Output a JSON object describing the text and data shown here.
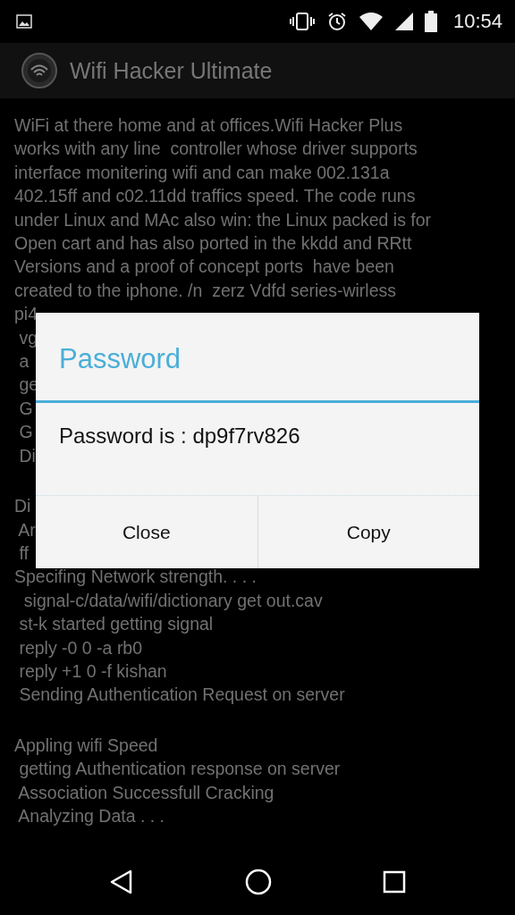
{
  "status_bar": {
    "time": "10:54"
  },
  "app_bar": {
    "title": "Wifi Hacker Ultimate"
  },
  "log_paragraphs": [
    [
      "WiFi at there home and at offices.Wifi Hacker Plus",
      "works with any line  controller whose driver supports",
      "interface monitering wifi and can make 002.131a",
      "402.15ff and c02.11dd traffics speed. The code runs",
      "under Linux and MAc also win: the Linux packed is for",
      "Open cart and has also ported in the kkdd and RRtt",
      "Versions and a proof of concept ports  have been",
      "created to the iphone. /n  zerz Vdfd series-wirless",
      "pi4",
      " vg",
      " a",
      " ge",
      " G",
      " G",
      " Di"
    ],
    [
      "Di",
      " Ar",
      " ff",
      "Specifing Network strength. . . .",
      "  signal-c/data/wifi/dictionary get out.cav",
      " st-k started getting signal",
      " reply -0 0 -a rb0",
      " reply +1 0 -f kishan",
      " Sending Authentication Request on server"
    ],
    [
      "Appling wifi Speed",
      " getting Authentication response on server",
      " Association Successfull Cracking",
      " Analyzing Data . . ."
    ]
  ],
  "dialog": {
    "title": "Password",
    "message": "Password is : dp9f7rv826",
    "buttons": [
      "Close",
      "Copy"
    ]
  }
}
